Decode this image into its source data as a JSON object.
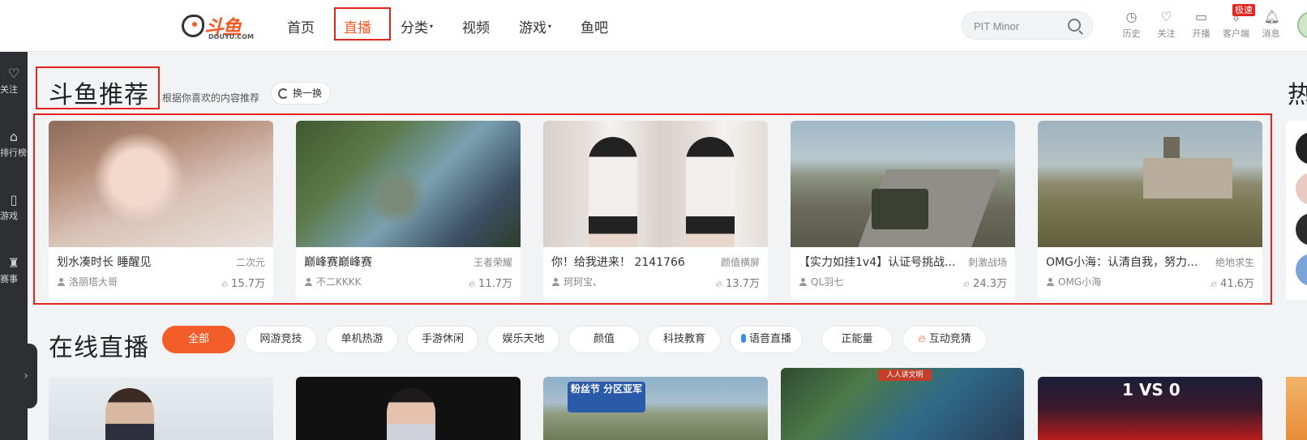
{
  "logo": {
    "text": "斗鱼",
    "sub": "DOUYU.COM"
  },
  "nav": {
    "items": [
      {
        "label": "首页",
        "dropdown": false,
        "active": false
      },
      {
        "label": "直播",
        "dropdown": false,
        "active": true
      },
      {
        "label": "分类",
        "dropdown": true,
        "active": false
      },
      {
        "label": "视频",
        "dropdown": false,
        "active": false
      },
      {
        "label": "游戏",
        "dropdown": true,
        "active": false
      },
      {
        "label": "鱼吧",
        "dropdown": false,
        "active": false
      }
    ]
  },
  "search": {
    "value": "PIT Minor",
    "icon": "search-icon"
  },
  "top_actions": [
    {
      "label": "历史",
      "icon": "clock-icon"
    },
    {
      "label": "关注",
      "icon": "heart-icon"
    },
    {
      "label": "开播",
      "icon": "camera-icon"
    },
    {
      "label": "客户端",
      "icon": "download-icon"
    },
    {
      "label": "消息",
      "icon": "bell-icon"
    }
  ],
  "speed_badge": "极速",
  "sidebar": {
    "items": [
      {
        "label": "关注",
        "icon": "heart-icon"
      },
      {
        "label": "排行榜",
        "icon": "rank-icon"
      },
      {
        "label": "游戏",
        "icon": "gamepad-icon"
      },
      {
        "label": "赛事",
        "icon": "trophy-icon"
      }
    ],
    "toggle": "›"
  },
  "recommend": {
    "title": "斗鱼推荐",
    "subtitle": "根据你喜欢的内容推荐",
    "refresh_label": "换一换",
    "cards": [
      {
        "title": "划水凑时长 睡醒见",
        "category": "二次元",
        "streamer": "洛丽塔大哥",
        "heat": "15.7万"
      },
      {
        "title": "巅峰赛巅峰赛",
        "category": "王者荣耀",
        "streamer": "不二KKKK",
        "heat": "11.7万"
      },
      {
        "title": "你！给我进来！ 2141766",
        "category": "颜值横屏",
        "streamer": "珂珂宝、",
        "heat": "13.7万"
      },
      {
        "title": "【实力如挂1v4】认证号挑战...",
        "category": "刺激战场",
        "streamer": "QL羽七",
        "heat": "24.3万"
      },
      {
        "title": "OMG小海：认清自我，努力...",
        "category": "绝地求生",
        "streamer": "OMG小海",
        "heat": "41.6万"
      }
    ]
  },
  "hot_title": "热",
  "live": {
    "title": "在线直播",
    "filters": [
      {
        "label": "全部",
        "active": true
      },
      {
        "label": "网游竞技",
        "active": false
      },
      {
        "label": "单机热游",
        "active": false
      },
      {
        "label": "手游休闲",
        "active": false
      },
      {
        "label": "娱乐天地",
        "active": false
      },
      {
        "label": "颜值",
        "active": false
      },
      {
        "label": "科技教育",
        "active": false
      },
      {
        "label": "语音直播",
        "active": false,
        "icon": "mic-icon"
      },
      {
        "label": "正能量",
        "active": false
      },
      {
        "label": "互动竞猜",
        "active": false,
        "icon": "fire-icon"
      }
    ],
    "thumb3_banner": "粉丝节 分区亚军",
    "thumb4_banner": "人人讲文明",
    "thumb5_score": "1 VS 0"
  },
  "colors": {
    "accent": "#f25d29",
    "highlight_box": "#e0261e",
    "sidebar_bg": "#2d2f33"
  }
}
